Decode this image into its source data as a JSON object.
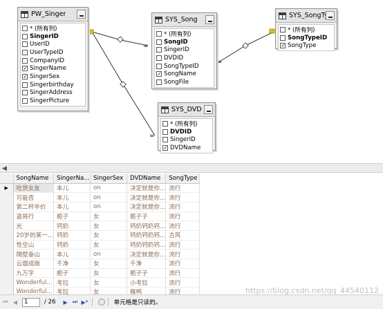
{
  "diagram": {
    "tables": [
      {
        "title": "PW_Singer",
        "columns": [
          {
            "label": "* (所有列)",
            "checked": false,
            "pk": false
          },
          {
            "label": "SingerID",
            "checked": false,
            "pk": true
          },
          {
            "label": "UserID",
            "checked": false,
            "pk": false
          },
          {
            "label": "UserTypeID",
            "checked": false,
            "pk": false
          },
          {
            "label": "CompanyID",
            "checked": false,
            "pk": false
          },
          {
            "label": "SingerName",
            "checked": true,
            "pk": false
          },
          {
            "label": "SingerSex",
            "checked": true,
            "pk": false
          },
          {
            "label": "Singerbirthday",
            "checked": false,
            "pk": false
          },
          {
            "label": "SingerAddress",
            "checked": false,
            "pk": false
          },
          {
            "label": "SingerPicture",
            "checked": false,
            "pk": false
          }
        ]
      },
      {
        "title": "SYS_Song",
        "columns": [
          {
            "label": "* (所有列)",
            "checked": false,
            "pk": false
          },
          {
            "label": "SongID",
            "checked": false,
            "pk": true
          },
          {
            "label": "SingerID",
            "checked": false,
            "pk": false
          },
          {
            "label": "DVDID",
            "checked": false,
            "pk": false
          },
          {
            "label": "SongTypeID",
            "checked": false,
            "pk": false
          },
          {
            "label": "SongName",
            "checked": true,
            "pk": false
          },
          {
            "label": "SongFile",
            "checked": false,
            "pk": false
          }
        ]
      },
      {
        "title": "SYS_SongTy...",
        "columns": [
          {
            "label": "* (所有列)",
            "checked": false,
            "pk": false
          },
          {
            "label": "SongTypeID",
            "checked": false,
            "pk": true
          },
          {
            "label": "SongType",
            "checked": true,
            "pk": false
          }
        ]
      },
      {
        "title": "SYS_DVD",
        "columns": [
          {
            "label": "* (所有列)",
            "checked": false,
            "pk": false
          },
          {
            "label": "DVDID",
            "checked": false,
            "pk": true
          },
          {
            "label": "SingerID",
            "checked": false,
            "pk": false
          },
          {
            "label": "DVDName",
            "checked": true,
            "pk": false
          }
        ]
      }
    ]
  },
  "results": {
    "headers": [
      "SongName",
      "SingerNa...",
      "SingerSex",
      "DVDName",
      "SongType"
    ],
    "rows": [
      [
        "吃货女友",
        "本儿",
        "on",
        "决定就是你...",
        "流行"
      ],
      [
        "可能否",
        "本儿",
        "on",
        "决定就是你...",
        "流行"
      ],
      [
        "第二杯半价",
        "本儿",
        "on",
        "决定就是你...",
        "流行"
      ],
      [
        "盗将行",
        "栀子",
        "女",
        "栀子子",
        "流行"
      ],
      [
        "光",
        "钙奶",
        "女",
        "钙奶钙奶钙...",
        "流行"
      ],
      [
        "20岁的某一...",
        "钙奶",
        "女",
        "钙奶钙奶钙...",
        "古风"
      ],
      [
        "性空山",
        "钙奶",
        "女",
        "钙奶钙奶钙...",
        "流行"
      ],
      [
        "隔壁泰山",
        "本儿",
        "on",
        "决定就是你...",
        "流行"
      ],
      [
        "云烟成雨",
        "千净",
        "女",
        "千净",
        "流行"
      ],
      [
        "九万字",
        "栀子",
        "女",
        "栀子子",
        "流行"
      ],
      [
        "Wonderful...",
        "考拉",
        "女",
        "小考拉",
        "流行"
      ],
      [
        "Wonderful...",
        "考拉",
        "女",
        "稚鸭",
        "流行"
      ]
    ],
    "selected_row": 0
  },
  "status": {
    "page_current": "1",
    "page_total": "/ 26",
    "message": "单元格是只读的。"
  },
  "watermark": "https://blog.csdn.net/qq_44540112",
  "colors": {
    "cell_text": "#8a6b54",
    "header_bg": "#f1f1f1",
    "nav_blue": "#2a4f9c"
  }
}
